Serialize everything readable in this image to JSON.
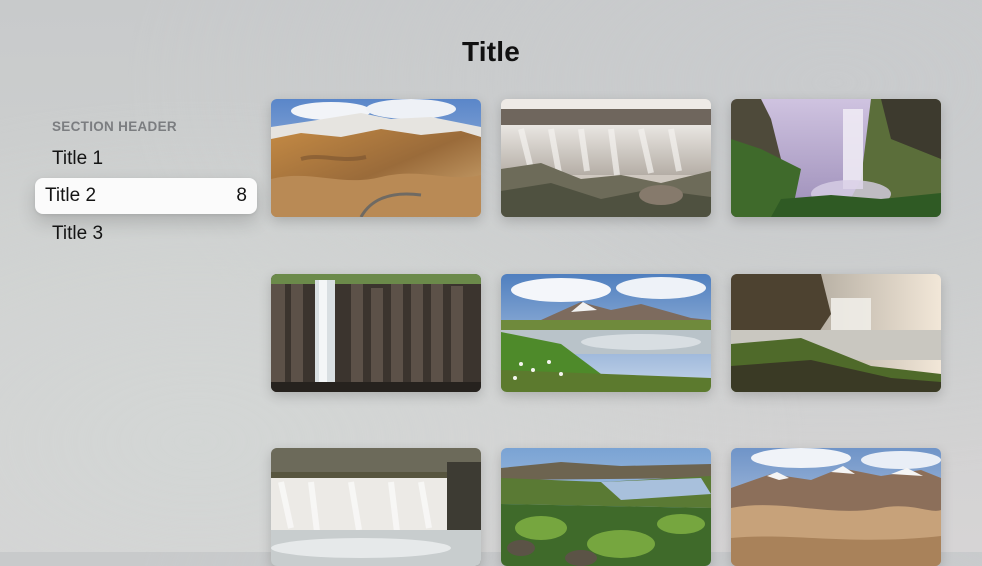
{
  "header": {
    "title": "Title"
  },
  "sidebar": {
    "section_header": "SECTION HEADER",
    "items": [
      {
        "label": "Title 1",
        "count": ""
      },
      {
        "label": "Title 2",
        "count": "8"
      },
      {
        "label": "Title 3",
        "count": ""
      }
    ],
    "selected_index": 1
  },
  "gallery": {
    "tiles": [
      {
        "subject": "mountain-landscape-photo"
      },
      {
        "subject": "waterfall-photo"
      },
      {
        "subject": "waterfall-cliff-photo"
      },
      {
        "subject": "basalt-waterfall-photo"
      },
      {
        "subject": "lake-meadow-photo"
      },
      {
        "subject": "coastal-waterfall-photo"
      },
      {
        "subject": "canyon-waterfall-photo"
      },
      {
        "subject": "river-moss-photo"
      },
      {
        "subject": "mountain-snow-photo"
      }
    ]
  }
}
